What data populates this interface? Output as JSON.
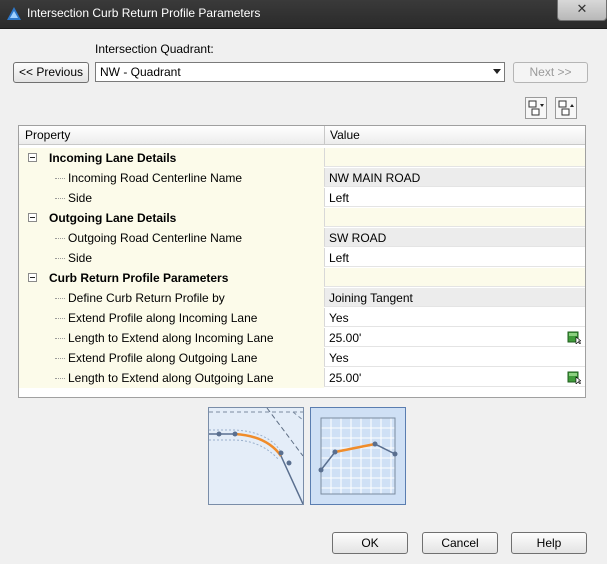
{
  "window": {
    "title": "Intersection Curb Return Profile Parameters",
    "close_glyph": "✕"
  },
  "quadrant": {
    "label": "Intersection Quadrant:",
    "selected": "NW - Quadrant",
    "previous_label": "<< Previous",
    "next_label": "Next >>"
  },
  "grid": {
    "headers": {
      "property": "Property",
      "value": "Value"
    },
    "rows": [
      {
        "kind": "category",
        "name": "Incoming Lane Details",
        "value": ""
      },
      {
        "kind": "readonly",
        "name": "Incoming Road Centerline Name",
        "value": "NW MAIN ROAD"
      },
      {
        "kind": "editable",
        "name": "Side",
        "value": "Left"
      },
      {
        "kind": "category",
        "name": "Outgoing Lane Details",
        "value": ""
      },
      {
        "kind": "readonly",
        "name": "Outgoing Road Centerline Name",
        "value": "SW ROAD"
      },
      {
        "kind": "editable",
        "name": "Side",
        "value": "Left"
      },
      {
        "kind": "category",
        "name": "Curb Return Profile Parameters",
        "value": ""
      },
      {
        "kind": "readonly",
        "name": "Define Curb Return Profile by",
        "value": "Joining Tangent"
      },
      {
        "kind": "editable",
        "name": "Extend Profile along Incoming Lane",
        "value": "Yes"
      },
      {
        "kind": "editable",
        "name": "Length to Extend along Incoming Lane",
        "value": "25.00'",
        "icon": "pick-icon"
      },
      {
        "kind": "editable",
        "name": "Extend Profile along Outgoing Lane",
        "value": "Yes"
      },
      {
        "kind": "editable",
        "name": "Length to Extend along Outgoing Lane",
        "value": "25.00'",
        "icon": "pick-icon"
      }
    ]
  },
  "toolbar": {
    "icons": [
      "collapse-all-icon",
      "expand-all-icon"
    ]
  },
  "previews": [
    "plan-view-preview",
    "profile-view-preview"
  ],
  "buttons": {
    "ok": "OK",
    "cancel": "Cancel",
    "help": "Help"
  },
  "colors": {
    "accent_orange": "#f08c2a",
    "title_bar": "#2f2f2f",
    "category_bg": "#fcfbea"
  }
}
